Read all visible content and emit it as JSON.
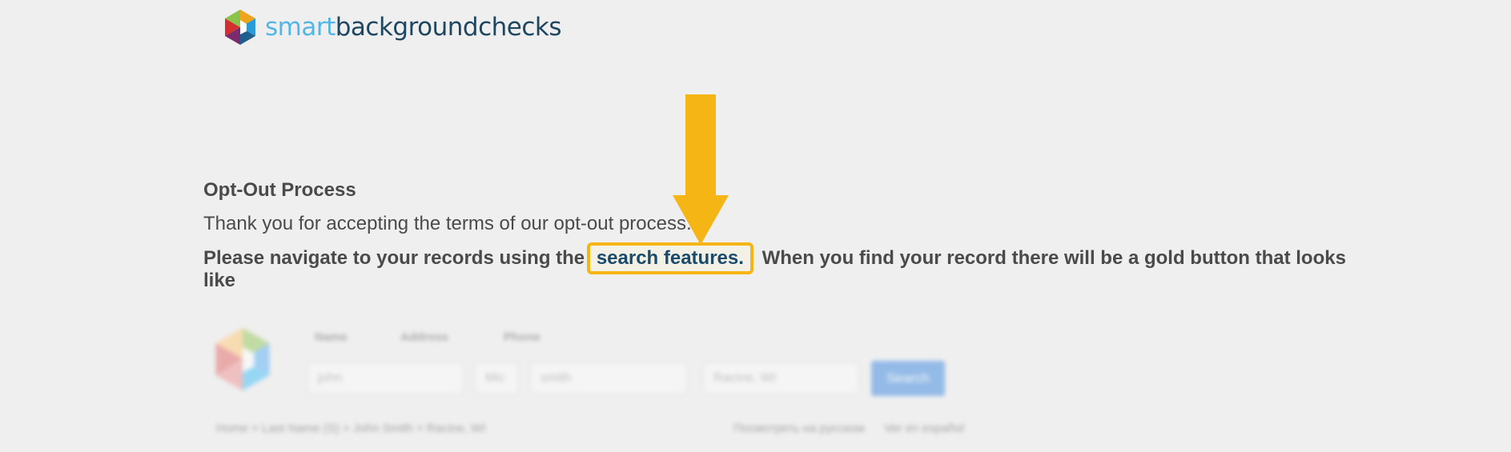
{
  "header": {
    "logo_smart": "smart",
    "logo_rest": "backgroundchecks"
  },
  "main": {
    "heading": "Opt-Out Process",
    "thanks_line": "Thank you for accepting the terms of our opt-out process.",
    "nav_before": "Please navigate to your records using the ",
    "search_link": "search features.",
    "nav_after": " When you find your record there will be a gold button that looks like"
  },
  "example_form": {
    "labels": {
      "name": "Name",
      "address": "Address",
      "phone": "Phone"
    },
    "first_name_value": "john",
    "middle_value": "Mic",
    "last_name_value": "smith",
    "location_value": "Racine, WI",
    "search_button": "Search",
    "breadcrumb": "Home > Last Name (S) > John Smith > Racine, WI",
    "lang_russian": "Посмотреть на русском",
    "lang_spanish": "Ver en español"
  },
  "colors": {
    "highlight": "#f5b514",
    "link": "#1b4b6b",
    "logo_light": "#52b6e6",
    "logo_dark": "#1f4660"
  },
  "icons": {
    "annotation": "down-arrow-icon",
    "logo": "hexagon-cube-logo-icon"
  }
}
